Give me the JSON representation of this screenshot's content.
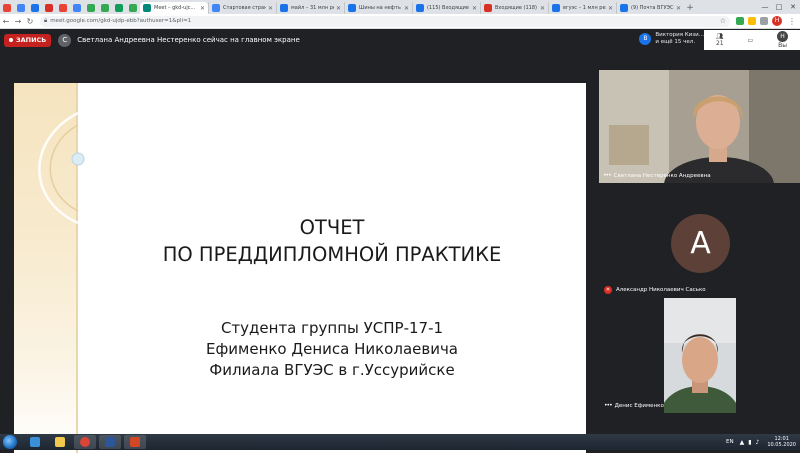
{
  "browser": {
    "mini_tabs": [
      {
        "color": "#ea4335"
      },
      {
        "color": "#4285f4"
      },
      {
        "color": "#1a73e8"
      },
      {
        "color": "#d93025"
      },
      {
        "color": "#ea4335"
      },
      {
        "color": "#4285f4"
      },
      {
        "color": "#34a853"
      },
      {
        "color": "#34a853"
      },
      {
        "color": "#0f9d58"
      },
      {
        "color": "#34a853"
      }
    ],
    "tabs": [
      {
        "title": "Meet – gkd-ujc...",
        "color": "#00897b",
        "active": true
      },
      {
        "title": "Стартовая страни...",
        "color": "#4285f4",
        "active": false
      },
      {
        "title": "майл – 31 млн рез...",
        "color": "#1a73e8",
        "active": false
      },
      {
        "title": "Шины на нефть по...",
        "color": "#1a73e8",
        "active": false
      },
      {
        "title": "(115) Входящие – ...",
        "color": "#1a73e8",
        "active": false
      },
      {
        "title": "Входящие (118) – ...",
        "color": "#d93025",
        "active": false
      },
      {
        "title": "вгуэс – 1 млн резу...",
        "color": "#1a73e8",
        "active": false
      },
      {
        "title": "(9) Почта ВГУЭС ...",
        "color": "#1a73e8",
        "active": false
      }
    ],
    "tab_close": "✕",
    "new_tab": "+",
    "url": "meet.google.com/gkd-ujdp-ebb?authuser=1&pli=1",
    "profile_letter": "Н"
  },
  "meet": {
    "record_label": "ЗАПИСЬ",
    "presenter_initial": "С",
    "presenter_status": "Светлана Андреевна Нестеренко сейчас на главном экране",
    "viewer": {
      "initial": "В",
      "line1": "Виктория Кизи...",
      "line2": "и ещё 15 чел."
    },
    "right_panel": {
      "count": "21",
      "user_label": "Вы",
      "user_initial": "Н"
    }
  },
  "slide": {
    "title_line1": "ОТЧЕТ",
    "title_line2": "ПО ПРЕДДИПЛОМНОЙ ПРАКТИКЕ",
    "sub_line1": "Студента группы УСПР-17-1",
    "sub_line2": "Ефименко Дениса Николаевича",
    "sub_line3": "Филиала ВГУЭС в г.Уссурийске"
  },
  "participants": [
    {
      "name": "Светлана Нестеренко Андреевна"
    },
    {
      "name": "Александр Николаевич Сасько",
      "initial": "А",
      "avatar_color": "#5d4037"
    },
    {
      "name": "Денис Ефименко"
    }
  ],
  "taskbar": {
    "apps": [
      {
        "name": "ie-icon",
        "color": "#3a8fd9"
      },
      {
        "name": "folder-icon",
        "color": "#f2c94c"
      },
      {
        "name": "chrome-icon",
        "color": "#db4437"
      },
      {
        "name": "word-icon",
        "color": "#2b579a"
      },
      {
        "name": "powerpoint-icon",
        "color": "#d24726"
      }
    ],
    "lang": "EN",
    "time": "12:01",
    "date": "10.05.2020"
  },
  "colors": {
    "meet_bg": "#202124",
    "record_red": "#c5221f",
    "slide_band": "#f6e4bf"
  }
}
